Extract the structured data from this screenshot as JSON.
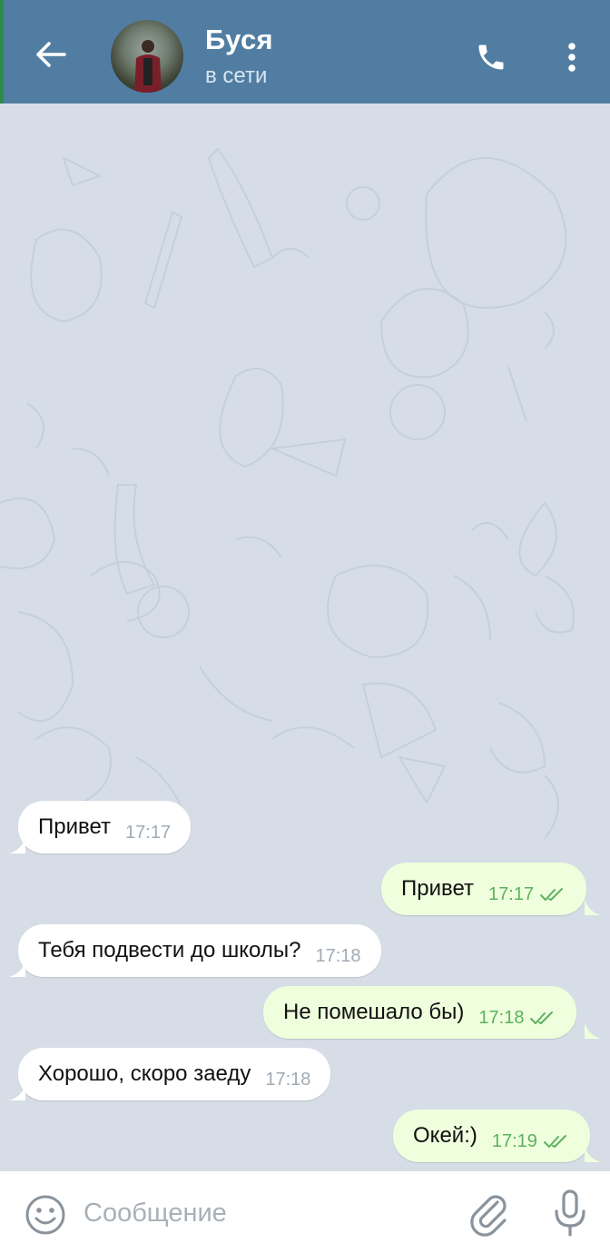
{
  "header": {
    "contact_name": "Буся",
    "status": "в сети",
    "icons": {
      "back": "arrow-left-icon",
      "call": "phone-icon",
      "menu": "more-vertical-icon"
    },
    "color": "#517da2"
  },
  "messages": [
    {
      "direction": "in",
      "text": "Привет",
      "time": "17:17"
    },
    {
      "direction": "out",
      "text": "Привет",
      "time": "17:17",
      "read": true
    },
    {
      "direction": "in",
      "text": "Тебя подвести до школы?",
      "time": "17:18"
    },
    {
      "direction": "out",
      "text": "Не помешало бы)",
      "time": "17:18",
      "read": true
    },
    {
      "direction": "in",
      "text": "Хорошо, скоро заеду",
      "time": "17:18"
    },
    {
      "direction": "out",
      "text": "Окей:)",
      "time": "17:19",
      "read": true
    }
  ],
  "composer": {
    "placeholder": "Сообщение",
    "icons": {
      "emoji": "smile-icon",
      "attach": "paperclip-icon",
      "mic": "microphone-icon"
    }
  },
  "colors": {
    "incoming_bubble": "#ffffff",
    "outgoing_bubble": "#effedd",
    "read_check": "#5bb25f",
    "chat_background": "#d6dde6"
  }
}
